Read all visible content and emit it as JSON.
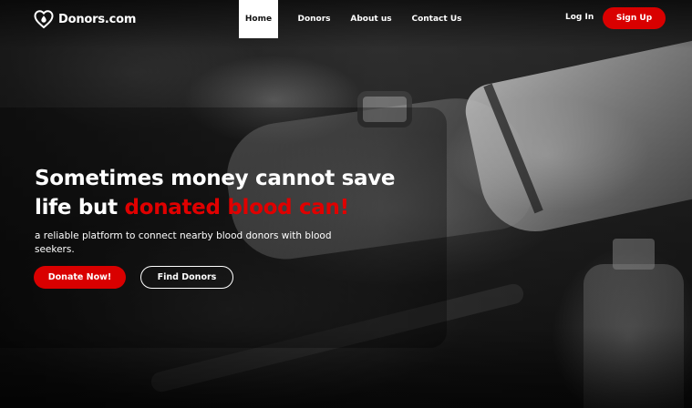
{
  "brand": {
    "name": "Donors.com",
    "logo_icon": "heart-drop-icon",
    "accent_color": "#d90000"
  },
  "nav": {
    "items": [
      {
        "label": "Home",
        "active": true
      },
      {
        "label": "Donors",
        "active": false
      },
      {
        "label": "About us",
        "active": false
      },
      {
        "label": "Contact Us",
        "active": false
      }
    ],
    "login_label": "Log In",
    "signup_label": "Sign Up"
  },
  "hero": {
    "headline_line1": "Sometimes money cannot save",
    "headline_line2_start": "life but ",
    "headline_highlight": "donated blood can!",
    "subtitle": "a reliable platform to connect nearby blood donors with blood seekers.",
    "primary_button": "Donate Now!",
    "secondary_button": "Find Donors"
  }
}
